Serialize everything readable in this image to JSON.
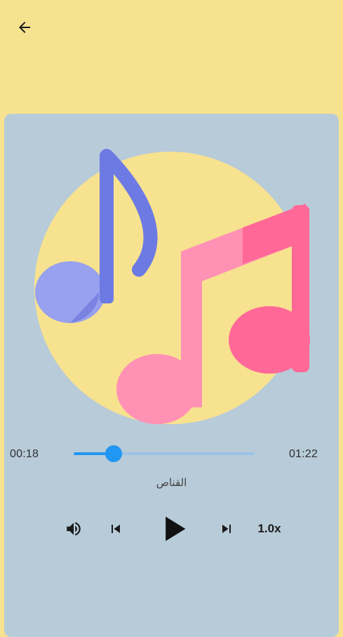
{
  "header": {
    "back_icon": "arrow-left-icon"
  },
  "player": {
    "elapsed": "00:18",
    "total": "01:22",
    "progress_fraction": 0.22,
    "track_title": "القناص",
    "speed_label": "1.0x",
    "icons": {
      "volume": "volume-icon",
      "previous": "skip-previous-icon",
      "play": "play-icon",
      "next": "skip-next-icon"
    }
  },
  "colors": {
    "background": "#F7E28F",
    "card": "#B8CBD9",
    "accent": "#2196F3"
  }
}
